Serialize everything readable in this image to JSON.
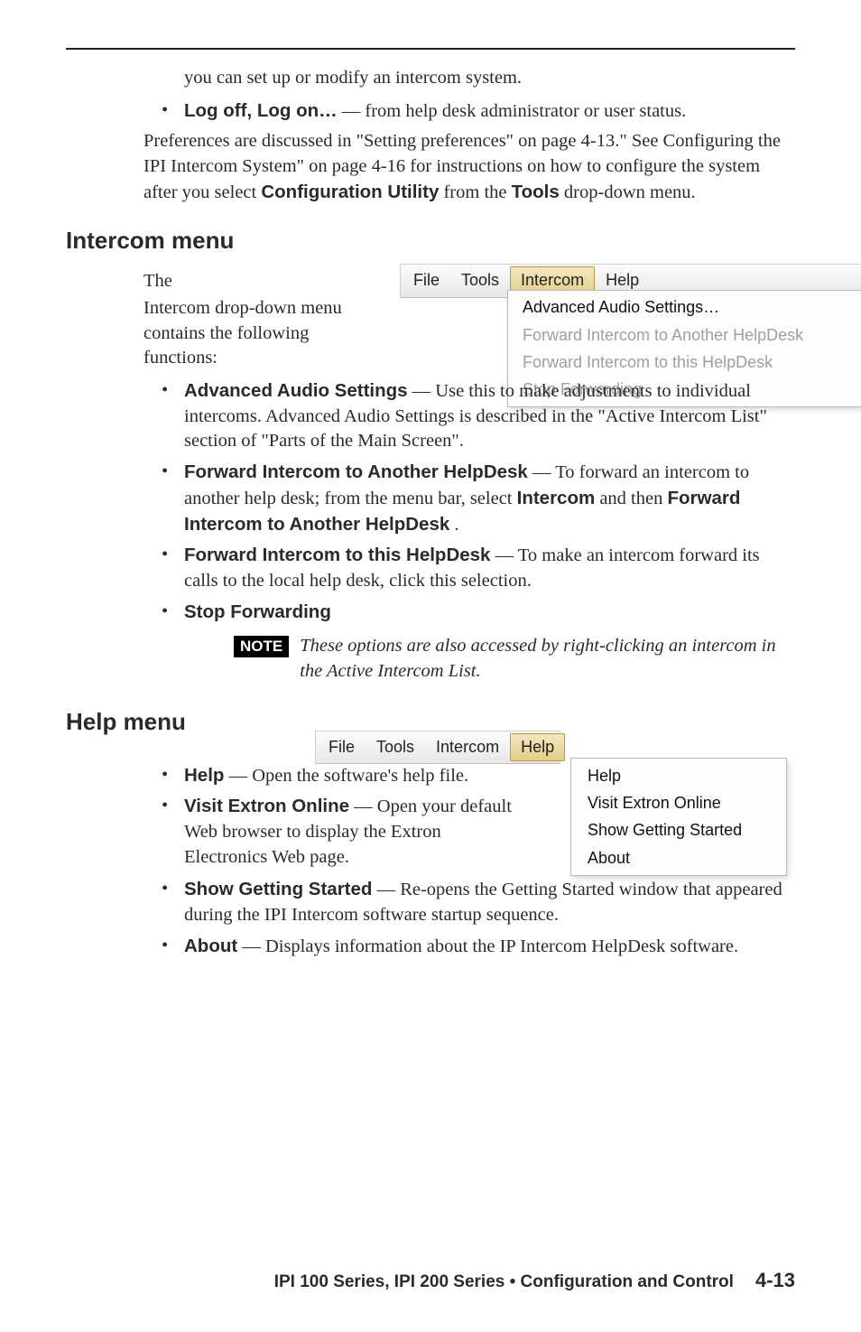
{
  "top": {
    "cont_line": "you can set up or modify an intercom system.",
    "logoff_label": "Log off, Log on…",
    "logoff_rest": "— from  help desk administrator or user status.",
    "prefs": "Preferences are discussed in \"Setting preferences\" on page 4-13.\"  See Configuring the IPI Intercom System\" on page 4-16 for instructions on how to configure the system after you select ",
    "config_util": "Configuration Utility",
    "from_the": " from the ",
    "tools_word": "Tools",
    "dd_suffix": " drop-down menu."
  },
  "intercom": {
    "heading": "Intercom menu",
    "text_the": "The",
    "text_rest": "Intercom drop-down menu contains the following functions:",
    "menubar": {
      "file": "File",
      "tools": "Tools",
      "intercom": "Intercom",
      "help": "Help"
    },
    "dd": {
      "i1": "Advanced Audio Settings…",
      "i2": "Forward Intercom to Another HelpDesk",
      "i3": "Forward Intercom to this HelpDesk",
      "i4": "Stop Forwarding"
    },
    "items": {
      "adv_label": "Advanced Audio Settings",
      "adv_rest": " — Use this to make adjustments to individual intercoms.  Advanced Audio Settings is described in the \"Active Intercom List\" section of  \"Parts of the Main Screen\".",
      "fwd_another_label": "Forward Intercom to Another HelpDesk",
      "fwd_another_mid": " — To forward an intercom to another help desk; from the menu bar, select ",
      "fwd_another_menu": "Intercom",
      "and_then": " and then ",
      "fwd_another_item": "Forward Intercom to Another HelpDesk",
      "period": ".",
      "fwd_this_label": "Forward Intercom to this HelpDesk",
      "fwd_this_rest": " — To make an intercom forward its calls to the local help desk, click this selection.",
      "stop_label": "Stop Forwarding"
    },
    "note_label": "NOTE",
    "note_text": "These options are also accessed by right-clicking an intercom in the Active Intercom List."
  },
  "help": {
    "heading": "Help menu",
    "menubar": {
      "file": "File",
      "tools": "Tools",
      "intercom": "Intercom",
      "help": "Help"
    },
    "dd": {
      "i1": "Help",
      "i2": "Visit Extron Online",
      "i3": "Show Getting Started",
      "i4": "About"
    },
    "items": {
      "help_label": "Help",
      "help_rest": " — Open the software's help file.",
      "visit_label": "Visit Extron Online",
      "visit_rest": " —  Open your default Web browser to display the Extron Electronics Web page.",
      "show_label": "Show Getting Started",
      "show_rest": " — Re-opens the Getting Started window that appeared during the IPI Intercom software startup sequence.",
      "about_label": "About",
      "about_rest": " — Displays information about the IP Intercom HelpDesk software."
    }
  },
  "footer": {
    "title": "IPI 100 Series, IPI 200 Series • Configuration and Control",
    "page": "4-13"
  }
}
